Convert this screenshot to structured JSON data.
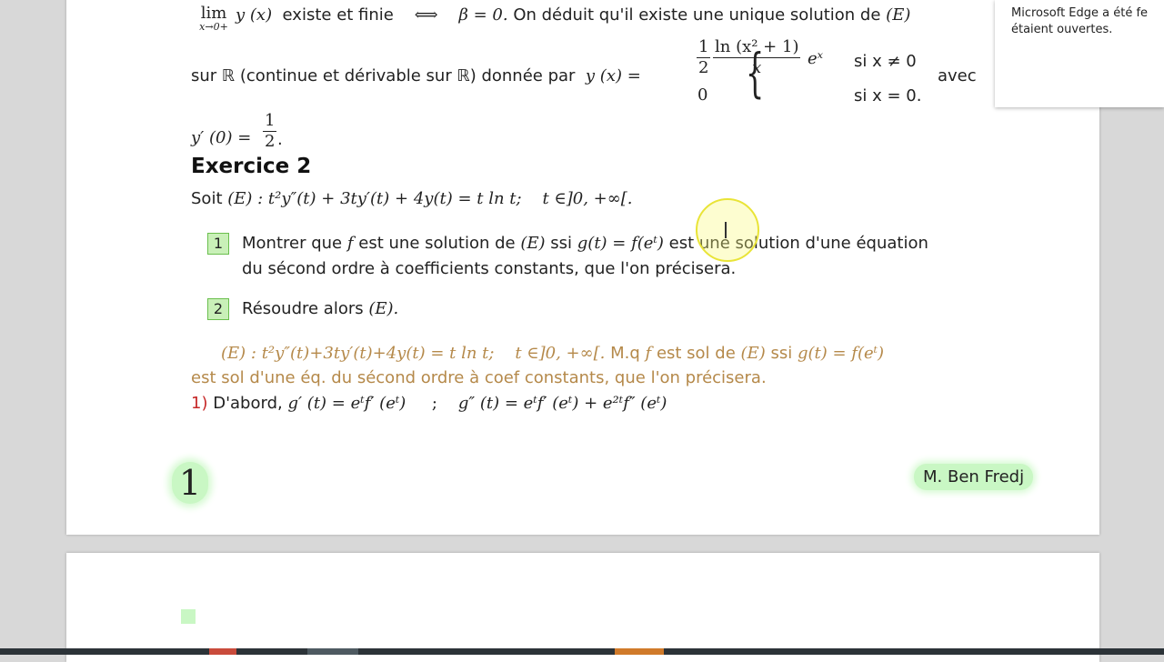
{
  "notification": {
    "line1": "Microsoft Edge a été fe",
    "line2": "étaient ouvertes."
  },
  "doc": {
    "line_limit": {
      "lim_word": "lim",
      "lim_sub": "x→0+",
      "expr": "y (x)",
      "text1": "existe et finie",
      "iff": "⟺",
      "beta": "β = 0.",
      "text2": "On déduit qu'il existe une unique solution de",
      "eq": "(E)"
    },
    "line_solution": {
      "text1": "sur ℝ (continue et dérivable sur ℝ) donnée par",
      "yx": "y (x) =",
      "frac_half_num": "1",
      "frac_half_den": "2",
      "frac_ln_num": "ln (x² + 1)",
      "frac_ln_den": "x",
      "exp": "eˣ",
      "case1_cond": "si x ≠ 0",
      "case2_val": "0",
      "case2_cond": "si x = 0.",
      "avec": "avec"
    },
    "line_yprime": {
      "lhs": "y′ (0) =",
      "num": "1",
      "den": "2",
      "dot": "."
    },
    "exercise_title": "Exercice 2",
    "statement": {
      "soit": "Soit",
      "eq": "(E) : t²y″(t) + 3ty′(t) + 4y(t) = t ln t;",
      "domain": "t ∈]0, +∞[."
    },
    "q1": {
      "num": "1",
      "line1_a": "Montrer que",
      "f": "f",
      "line1_b": "est une solution de",
      "E": "(E)",
      "ssi": "ssi",
      "g": "g(t) = f(eᵗ)",
      "line1_c": "est une solution d'une équation",
      "line2": "du sécond ordre à coefficients constants, que l'on précisera."
    },
    "q2": {
      "num": "2",
      "text": "Résoudre alors",
      "E": "(E)."
    },
    "recap": {
      "eq": "(E) : t²y″(t)+3ty′(t)+4y(t) = t ln t;",
      "domain": "t ∈]0, +∞[.",
      "mq": "M.q",
      "f": "f",
      "est_sol": "est sol de",
      "E": "(E)",
      "ssi": "ssi",
      "g": "g(t) = f(eᵗ)",
      "line2": "est sol d'une éq. du sécond ordre à coef constants, que l'on précisera."
    },
    "step1": {
      "num": "1)",
      "text": "D'abord,",
      "gprime": "g′ (t) = eᵗf′ (eᵗ)",
      "sep": ";",
      "gsecond": "g″ (t) = eᵗf′ (eᵗ) + e²ᵗf″ (eᵗ)"
    },
    "page_number": "1",
    "author": "M. Ben Fredj"
  }
}
